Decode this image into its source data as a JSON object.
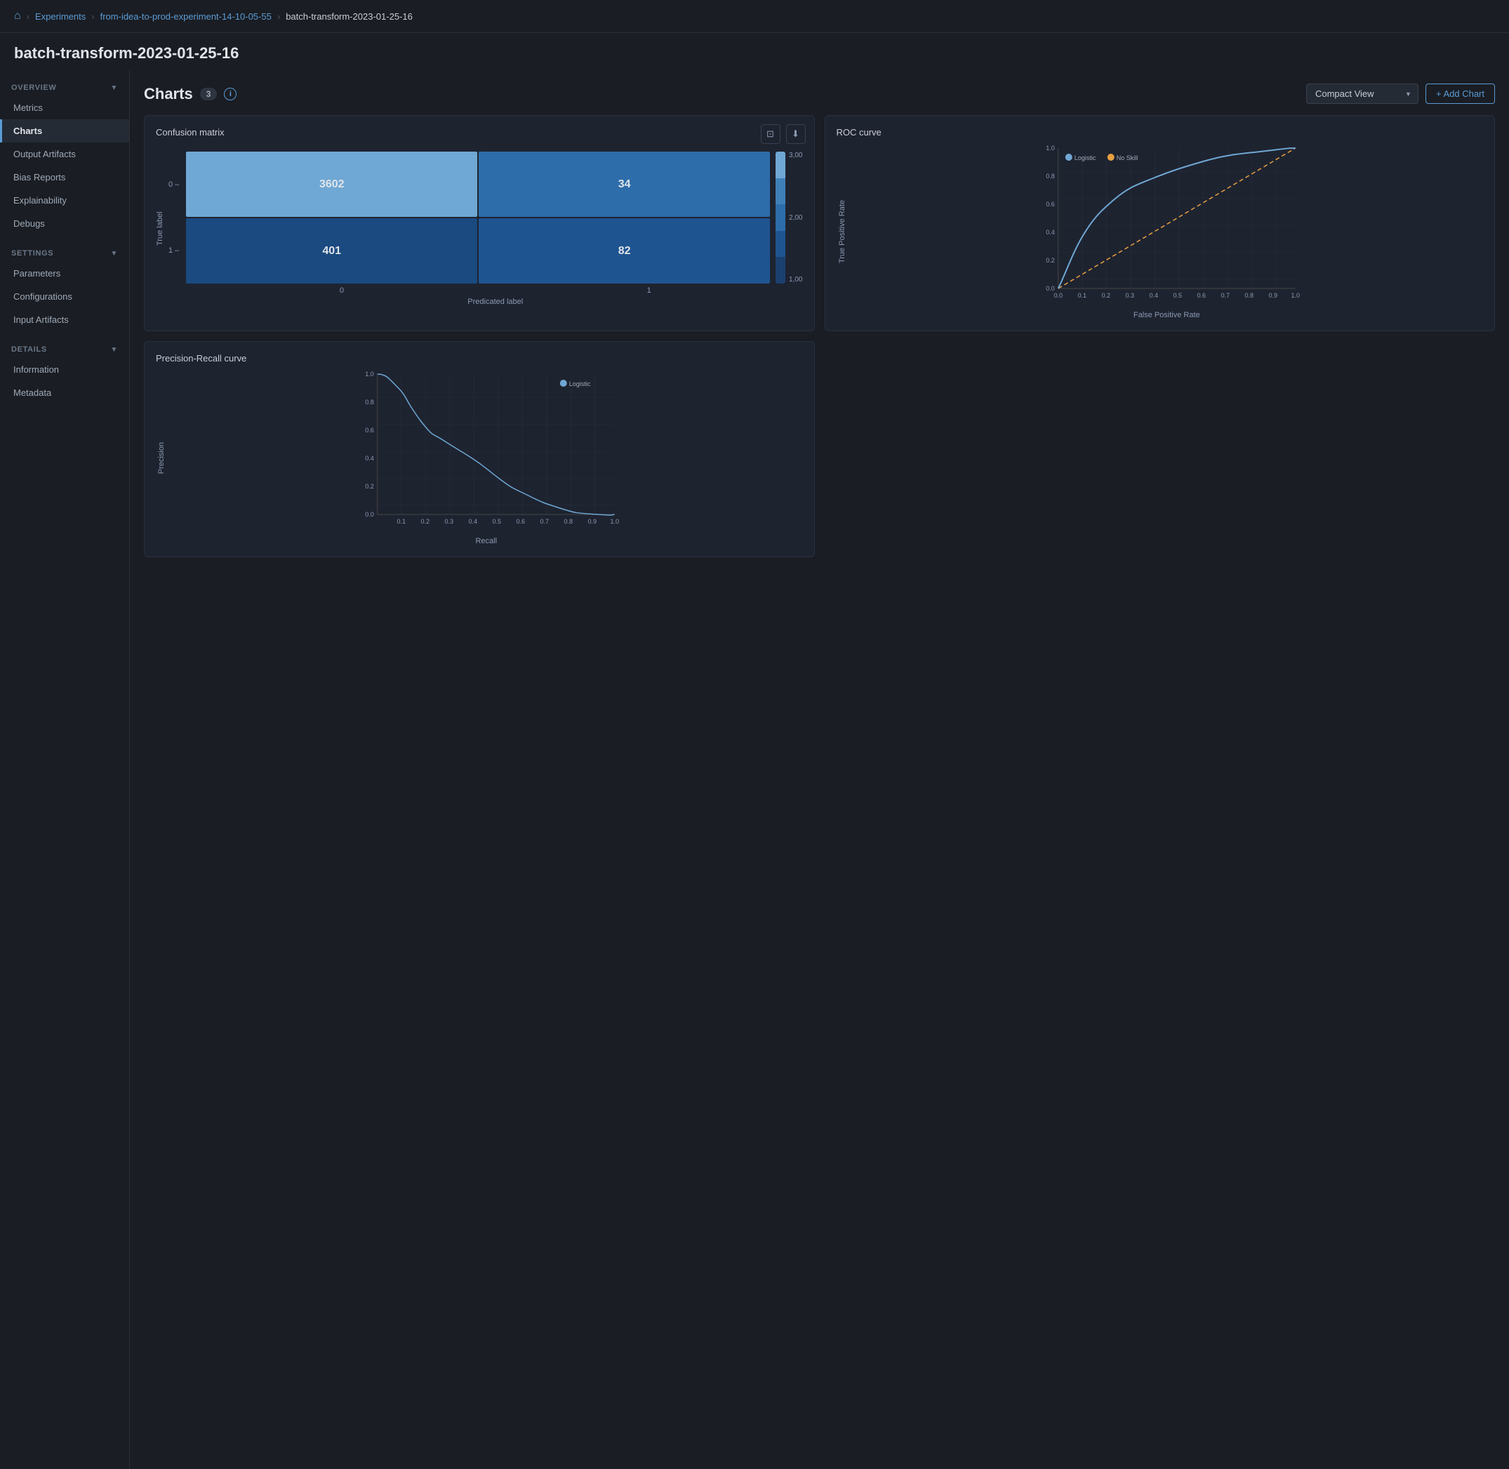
{
  "breadcrumb": {
    "home_icon": "🏠",
    "experiments_label": "Experiments",
    "experiment_name": "from-idea-to-prod-experiment-14-10-05-55",
    "run_name": "batch-transform-2023-01-25-16"
  },
  "page_title": "batch-transform-2023-01-25-16",
  "sidebar": {
    "overview_section": "OVERVIEW",
    "settings_section": "SETTINGS",
    "details_section": "DETAILS",
    "items_overview": [
      {
        "label": "Metrics",
        "active": false
      },
      {
        "label": "Charts",
        "active": true
      },
      {
        "label": "Output Artifacts",
        "active": false
      },
      {
        "label": "Bias Reports",
        "active": false
      },
      {
        "label": "Explainability",
        "active": false
      },
      {
        "label": "Debugs",
        "active": false
      }
    ],
    "items_settings": [
      {
        "label": "Parameters",
        "active": false
      },
      {
        "label": "Configurations",
        "active": false
      },
      {
        "label": "Input Artifacts",
        "active": false
      }
    ],
    "items_details": [
      {
        "label": "Information",
        "active": false
      },
      {
        "label": "Metadata",
        "active": false
      }
    ]
  },
  "charts_section": {
    "title": "Charts",
    "count": "3",
    "compact_view_label": "Compact View",
    "add_chart_label": "+ Add Chart",
    "info_symbol": "i"
  },
  "confusion_matrix": {
    "title": "Confusion matrix",
    "values": {
      "top_left": "3602",
      "top_right": "34",
      "bottom_left": "401",
      "bottom_right": "82"
    },
    "x_labels": [
      "0",
      "1"
    ],
    "y_labels": [
      "0",
      "1"
    ],
    "x_title": "Predicated label",
    "y_title": "True label",
    "colorbar_labels": [
      "3,00",
      "2,00",
      "1,00"
    ]
  },
  "roc_curve": {
    "title": "ROC curve",
    "x_label": "False Positive Rate",
    "y_label": "True Positive Rate",
    "legend": [
      {
        "label": "Logistic",
        "color": "#6fa8d4"
      },
      {
        "label": "No Skill",
        "color": "#e8a040"
      }
    ],
    "x_ticks": [
      "0.0",
      "0.1",
      "0.2",
      "0.3",
      "0.4",
      "0.5",
      "0.6",
      "0.7",
      "0.8",
      "0.9",
      "1.0"
    ],
    "y_ticks": [
      "0.0",
      "0.2",
      "0.4",
      "0.6",
      "0.8",
      "1.0"
    ]
  },
  "precision_recall": {
    "title": "Precision-Recall curve",
    "x_label": "Recall",
    "y_label": "Precision",
    "legend": [
      {
        "label": "Logistic",
        "color": "#6fa8d4"
      }
    ],
    "x_ticks": [
      "0.1",
      "0.2",
      "0.3",
      "0.4",
      "0.5",
      "0.6",
      "0.7",
      "0.8",
      "0.9",
      "1.0"
    ],
    "y_ticks": [
      "0.0",
      "0.2",
      "0.4",
      "0.6",
      "0.8",
      "1.0"
    ]
  }
}
